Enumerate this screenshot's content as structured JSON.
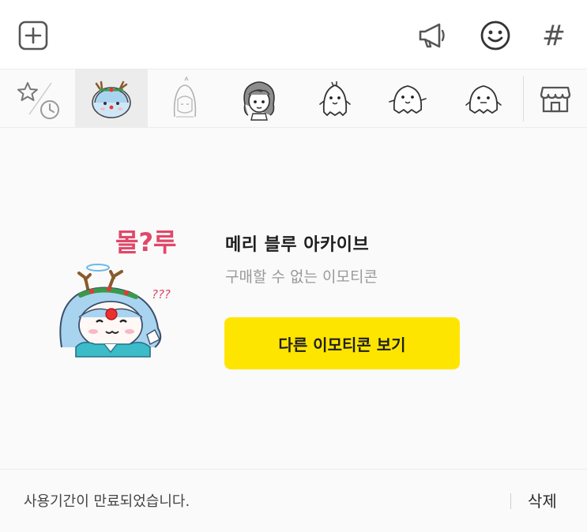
{
  "toolbar": {
    "icons": [
      "plus-square-icon",
      "megaphone-icon",
      "smiley-icon",
      "hash-icon"
    ],
    "hash_symbol": "#"
  },
  "tabs": [
    {
      "name": "favorites-recent",
      "icon": "star-clock-icon",
      "selected": false
    },
    {
      "name": "merry-blue-archive",
      "icon": "reindeer-girl-sticker",
      "selected": true
    },
    {
      "name": "pack-girl-sketch",
      "icon": "sketch-girl-sticker",
      "selected": false
    },
    {
      "name": "pack-curly-hair",
      "icon": "curly-hair-girl-sticker",
      "selected": false
    },
    {
      "name": "pack-ghost-1",
      "icon": "ghost-sticker",
      "selected": false
    },
    {
      "name": "pack-ghost-2",
      "icon": "ghost-sticker",
      "selected": false
    },
    {
      "name": "pack-ghost-3",
      "icon": "ghost-sticker",
      "selected": false
    }
  ],
  "store_icon": "emoticon-shop-icon",
  "sticker": {
    "caption_main": "몰?루",
    "caption_question": "???"
  },
  "pack": {
    "title": "메리 블루 아카이브",
    "subtitle": "구매할 수 없는 이모티콘",
    "action_label": "다른 이모티콘 보기"
  },
  "footer": {
    "message": "사용기간이 만료되었습니다.",
    "delete_label": "삭제"
  },
  "colors": {
    "accent_yellow": "#fee500",
    "selected_tab": "#ececec",
    "background": "#fafafa"
  }
}
